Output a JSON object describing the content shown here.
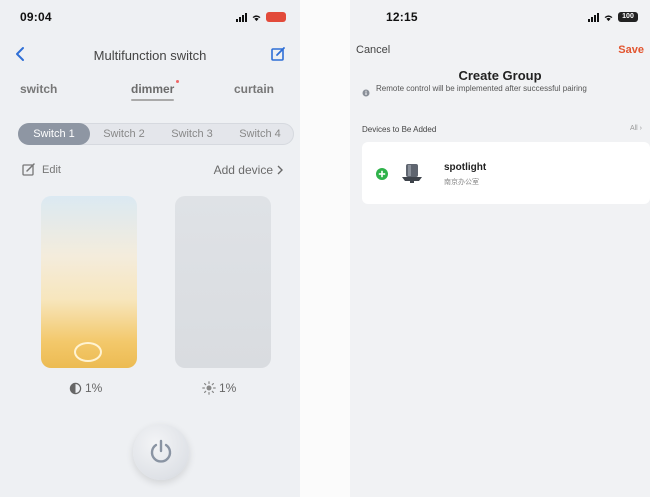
{
  "left": {
    "status": {
      "time": "09:04"
    },
    "nav": {
      "title": "Multifunction switch"
    },
    "modes": [
      "switch",
      "dimmer",
      "curtain"
    ],
    "active_mode": "dimmer",
    "switch_tabs": [
      "Switch 1",
      "Switch 2",
      "Switch 3",
      "Switch 4"
    ],
    "active_switch": "Switch 1",
    "edit_label": "Edit",
    "add_device_label": "Add device",
    "color_temp_value": "1%",
    "brightness_value": "1%",
    "colors": {
      "warm_top": "#dbe9f2",
      "warm_bottom": "#ecbb52",
      "grey": "#dcdfe3",
      "switch_active": "#8e96a3"
    }
  },
  "right": {
    "status": {
      "time": "12:15",
      "battery": "100"
    },
    "nav": {
      "cancel": "Cancel",
      "save": "Save"
    },
    "title": "Create Group",
    "info": "Remote control will be implemented after successful pairing",
    "section_header": "Devices to Be Added",
    "all_link": "All",
    "devices": [
      {
        "name": "spotlight",
        "room": "南京办公室",
        "icon": "spotlight-lamp-icon"
      }
    ],
    "colors": {
      "accent": "#e2552f",
      "add": "#2fb24a"
    }
  }
}
